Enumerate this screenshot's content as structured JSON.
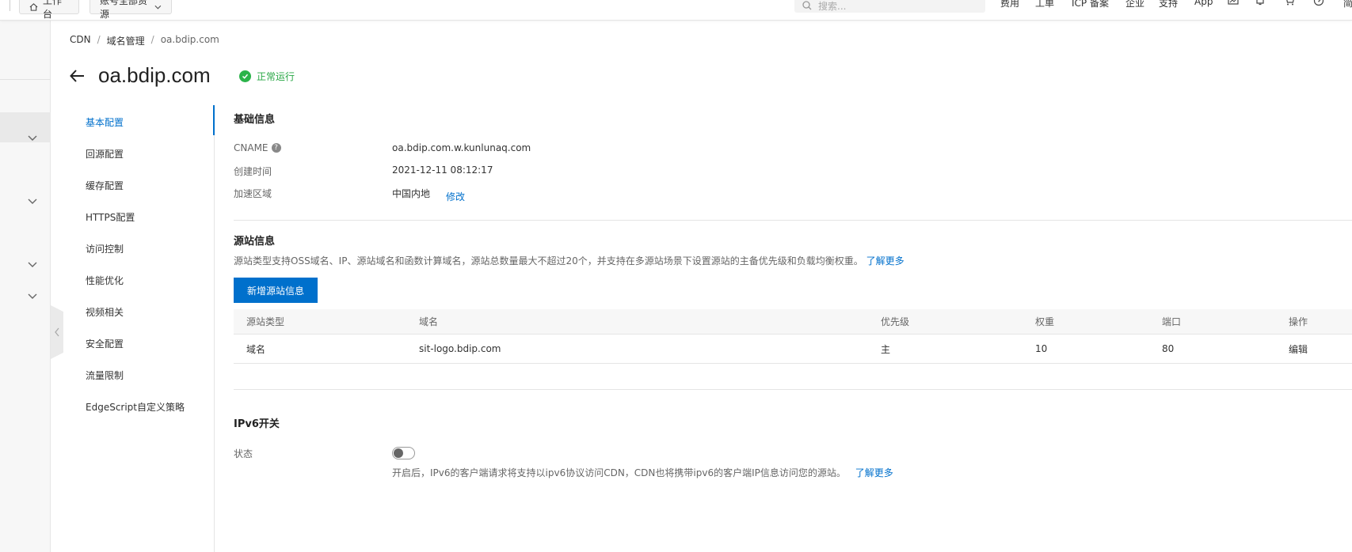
{
  "topbar": {
    "workbench_label": "工作台",
    "resource_label": "账号全部资源",
    "search_placeholder": "搜索...",
    "nav": [
      "费用",
      "工单",
      "ICP 备案",
      "企业",
      "支持",
      "App"
    ],
    "icons": [
      "screen-icon",
      "bell-icon",
      "cart-icon",
      "help-icon"
    ],
    "overflow_text": "简"
  },
  "breadcrumb": {
    "items": [
      "CDN",
      "域名管理",
      "oa.bdip.com"
    ],
    "separator": "/"
  },
  "header": {
    "title": "oa.bdip.com",
    "status": "正常运行",
    "status_color": "#2bb34a"
  },
  "menu": {
    "items": [
      "基本配置",
      "回源配置",
      "缓存配置",
      "HTTPS配置",
      "访问控制",
      "性能优化",
      "视频相关",
      "安全配置",
      "流量限制",
      "EdgeScript自定义策略"
    ],
    "active_index": 0,
    "accent_color": "#0070cc"
  },
  "basic_info": {
    "title": "基础信息",
    "cname_label": "CNAME",
    "cname_value": "oa.bdip.com.w.kunlunaq.com",
    "created_label": "创建时间",
    "created_value": "2021-12-11 08:12:17",
    "region_label": "加速区域",
    "region_value": "中国内地",
    "region_edit": "修改"
  },
  "origin_info": {
    "title": "源站信息",
    "description": "源站类型支持OSS域名、IP、源站域名和函数计算域名，源站总数量最大不超过20个，并支持在多源站场景下设置源站的主备优先级和负载均衡权重。",
    "learn_more": "了解更多",
    "add_button": "新增源站信息",
    "table": {
      "headers": [
        "源站类型",
        "域名",
        "优先级",
        "权重",
        "端口",
        "操作"
      ],
      "rows": [
        {
          "type": "域名",
          "domain": "sit-logo.bdip.com",
          "priority": "主",
          "weight": "10",
          "port": "80",
          "action": "编辑"
        }
      ]
    }
  },
  "ipv6": {
    "title": "IPv6开关",
    "status_label": "状态",
    "enabled": false,
    "description": "开启后，IPv6的客户端请求将支持以ipv6协议访问CDN，CDN也将携带ipv6的客户端IP信息访问您的源站。",
    "learn_more": "了解更多"
  }
}
